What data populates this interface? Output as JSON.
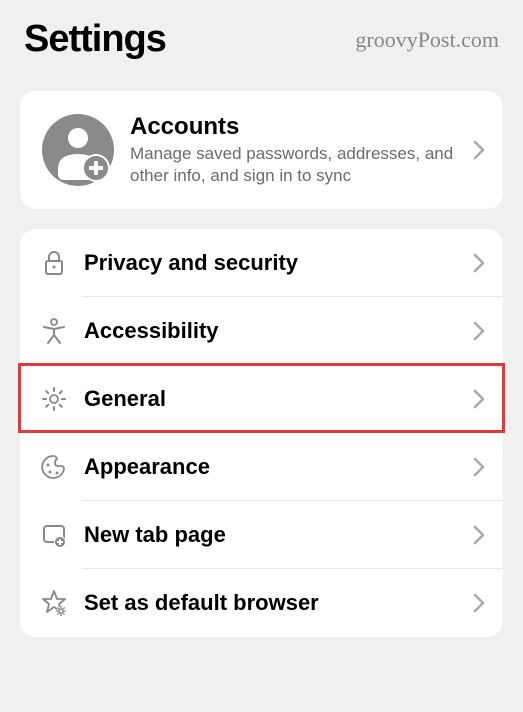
{
  "header": {
    "title": "Settings",
    "watermark": "groovyPost.com"
  },
  "accounts": {
    "title": "Accounts",
    "subtitle": "Manage saved passwords, addresses, and other info, and sign in to sync"
  },
  "menu": {
    "items": [
      {
        "label": "Privacy and security",
        "icon": "lock-icon"
      },
      {
        "label": "Accessibility",
        "icon": "accessibility-icon"
      },
      {
        "label": "General",
        "icon": "gear-icon"
      },
      {
        "label": "Appearance",
        "icon": "palette-icon"
      },
      {
        "label": "New tab page",
        "icon": "new-tab-icon"
      },
      {
        "label": "Set as default browser",
        "icon": "star-icon"
      }
    ]
  },
  "highlighted_index": 2
}
